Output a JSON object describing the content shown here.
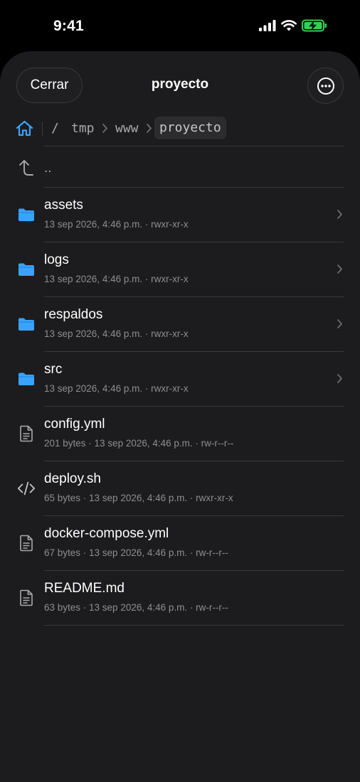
{
  "status_bar": {
    "time": "9:41",
    "icons": [
      "signal-icon",
      "wifi-icon",
      "battery-charging-icon"
    ],
    "battery_color": "#30d158"
  },
  "header": {
    "close_label": "Cerrar",
    "title": "proyecto",
    "more_icon": "ellipsis-circle-icon"
  },
  "breadcrumb": {
    "home_icon": "house-icon",
    "root": "/",
    "segments": [
      "tmp",
      "www",
      "proyecto"
    ],
    "accent": "#3aa3ff"
  },
  "parent_entry": {
    "label": "..",
    "icon": "arrow-up-turn-icon"
  },
  "entries": [
    {
      "name": "assets",
      "meta": "13 sep 2026, 4:46 p.m. · rwxr-xr-x",
      "type": "folder",
      "icon": "folder-icon"
    },
    {
      "name": "logs",
      "meta": "13 sep 2026, 4:46 p.m. · rwxr-xr-x",
      "type": "folder",
      "icon": "folder-icon"
    },
    {
      "name": "respaldos",
      "meta": "13 sep 2026, 4:46 p.m. · rwxr-xr-x",
      "type": "folder",
      "icon": "folder-icon"
    },
    {
      "name": "src",
      "meta": "13 sep 2026, 4:46 p.m. · rwxr-xr-x",
      "type": "folder",
      "icon": "folder-icon"
    },
    {
      "name": "config.yml",
      "meta": "201 bytes · 13 sep 2026, 4:46 p.m. · rw-r--r--",
      "type": "file",
      "icon": "document-icon"
    },
    {
      "name": "deploy.sh",
      "meta": "65 bytes · 13 sep 2026, 4:46 p.m. · rwxr-xr-x",
      "type": "script",
      "icon": "code-icon"
    },
    {
      "name": "docker-compose.yml",
      "meta": "67 bytes · 13 sep 2026, 4:46 p.m. · rw-r--r--",
      "type": "file",
      "icon": "document-icon"
    },
    {
      "name": "README.md",
      "meta": "63 bytes · 13 sep 2026, 4:46 p.m. · rw-r--r--",
      "type": "file",
      "icon": "document-icon"
    }
  ],
  "colors": {
    "folder": "#3aa3ff",
    "background": "#1c1c1e",
    "secondary_text": "#8e8e93"
  }
}
